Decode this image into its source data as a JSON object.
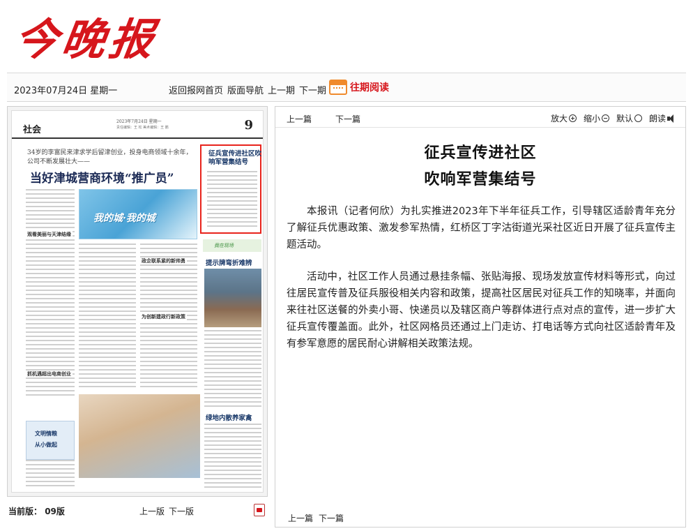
{
  "masthead": {
    "logo": "今晚报"
  },
  "topbar": {
    "date": "2023年07月24日 星期一",
    "nav": [
      "返回报网首页",
      "版面导航",
      "上一期",
      "下一期"
    ],
    "past_reading": "往期阅读"
  },
  "paper": {
    "section": "社会",
    "page_num": "9",
    "date_line": "2023年7月24日 星期一",
    "editor_line": "责任编辑：王 松  美术编辑：王 鹏",
    "lead_sub": "34岁的李富民来津求学后留津创业，投身电商领域十余年，公司不断发展壮大——",
    "lead_title": "当好津城营商环境“推广员”",
    "hero_text": "我的城·我的城",
    "sub_heads": [
      "观看美丽与天津结缘",
      "抓机遇超出电商创业",
      "政企联系紧的新帅勇",
      "为创新建政行新政策"
    ],
    "highlight_title": "征兵宣传进社区吹响军营集结号",
    "banner": "我在现场",
    "side_title_1": "提示牌弯折难辨",
    "side_title_2": "绿地内散养家禽",
    "wm_box": [
      "文明情粮",
      "从小做起"
    ]
  },
  "below_left": {
    "current_label": "当前版：",
    "current_value": "09版",
    "prev": "上一版",
    "next": "下一版"
  },
  "article": {
    "prev": "上一篇",
    "next": "下一篇",
    "tools": {
      "zoom_in": "放大",
      "zoom_out": "缩小",
      "default": "默认",
      "read": "朗读"
    },
    "title_line1": "征兵宣传进社区",
    "title_line2": "吹响军营集结号",
    "paragraphs": [
      "本报讯（记者何欣）为扎实推进2023年下半年征兵工作，引导辖区适龄青年充分了解征兵优惠政策、激发参军热情，红桥区丁字沽街道光采社区近日开展了征兵宣传主题活动。",
      "活动中，社区工作人员通过悬挂条幅、张贴海报、现场发放宣传材料等形式，向过往居民宣传普及征兵服役相关内容和政策，提高社区居民对征兵工作的知晓率，并面向来往社区送餐的外卖小哥、快递员以及辖区商户等群体进行点对点的宣传，进一步扩大征兵宣传覆盖面。此外，社区网格员还通过上门走访、打电话等方式向社区适龄青年及有参军意愿的居民耐心讲解相关政策法规。"
    ],
    "bottom_prev": "上一篇",
    "bottom_next": "下一篇"
  },
  "colors": {
    "brand_red": "#d6161c",
    "highlight_border": "#e8231c",
    "title_blue": "#1b3a6a"
  }
}
